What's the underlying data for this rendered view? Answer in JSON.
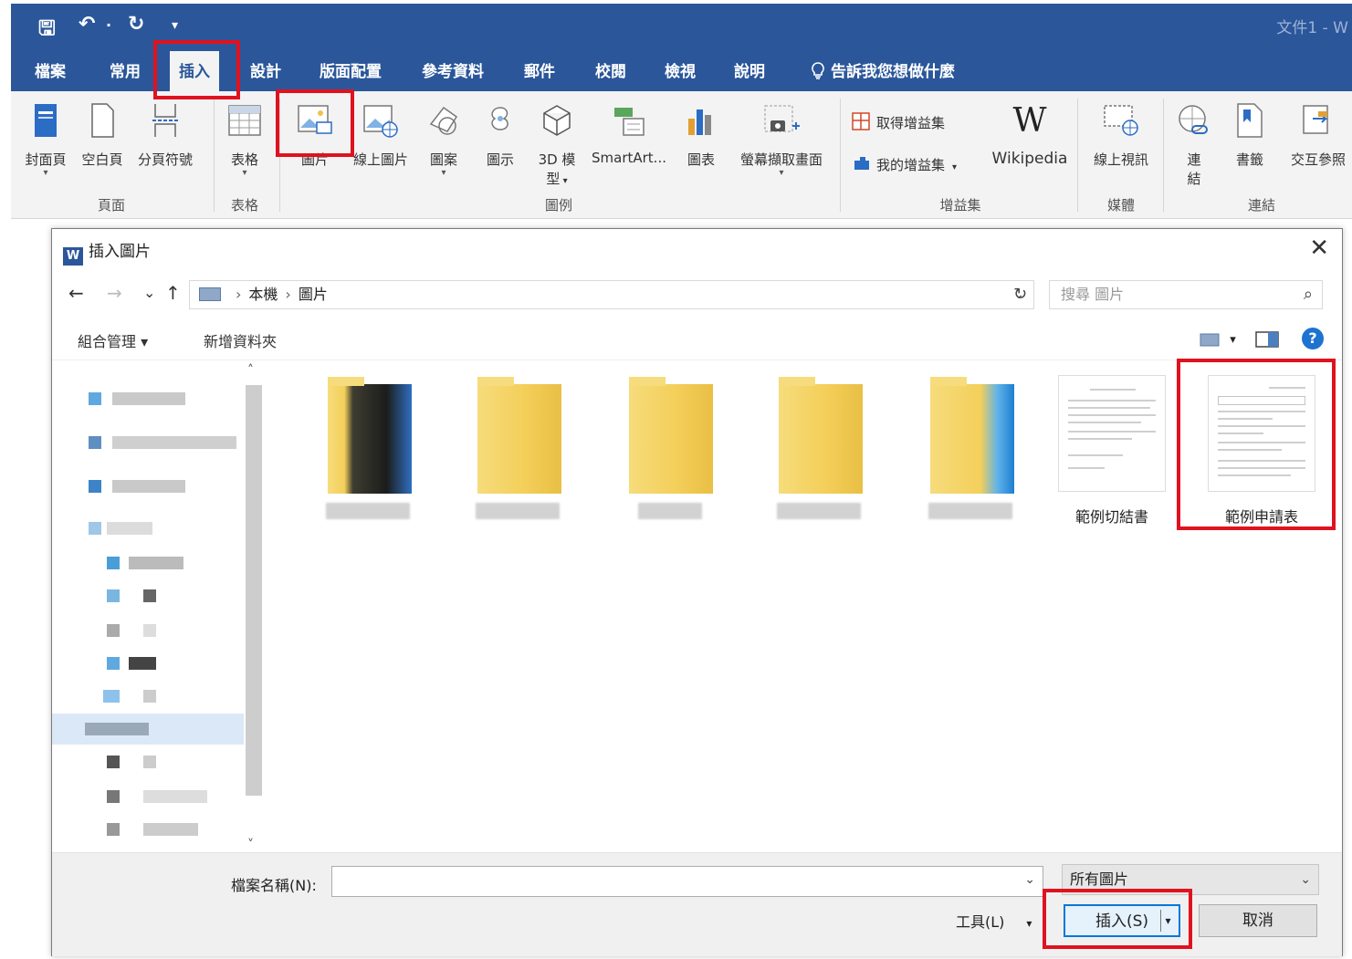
{
  "window": {
    "doc_title": "文件1 - W",
    "qat": {
      "save": "🖫",
      "undo": "↶",
      "undo_dd": "·",
      "redo": "↻",
      "more": "▾"
    }
  },
  "tabs": [
    "檔案",
    "常用",
    "插入",
    "設計",
    "版面配置",
    "參考資料",
    "郵件",
    "校閱",
    "檢視",
    "說明"
  ],
  "tell_me": "告訴我您想做什麼",
  "ribbon": {
    "pages": {
      "cover": "封面頁",
      "blank": "空白頁",
      "break": "分頁符號",
      "group": "頁面"
    },
    "tables": {
      "table": "表格",
      "group": "表格"
    },
    "illustrations": {
      "picture": "圖片",
      "online_picture": "線上圖片",
      "shapes": "圖案",
      "icons": "圖示",
      "model3d": "3D 模",
      "model3d_line2": "型",
      "smartart": "SmartArt...",
      "chart": "圖表",
      "screenshot": "螢幕擷取畫面",
      "group": "圖例"
    },
    "addins": {
      "get": "取得增益集",
      "my": "我的增益集",
      "wikipedia": "Wikipedia",
      "wiki_icon": "W",
      "group": "增益集"
    },
    "media": {
      "online_video": "線上視訊",
      "group": "媒體"
    },
    "links": {
      "link": "連",
      "link_line2": "結",
      "bookmark": "書籤",
      "xref": "交互參照",
      "group": "連結"
    }
  },
  "dialog": {
    "title": "插入圖片",
    "word_icon": "W",
    "close": "✕",
    "nav": {
      "back": "←",
      "forward": "→",
      "recent": "⌄",
      "up": "↑"
    },
    "breadcrumb": [
      "本機",
      "圖片"
    ],
    "breadcrumb_sep": "›",
    "address_dd": "⌄",
    "refresh": "↻",
    "search_placeholder": "搜尋 圖片",
    "search_icon": "⌕",
    "organize": "組合管理 ▾",
    "new_folder": "新增資料夾",
    "view_dd": "▾",
    "help": "?",
    "scroll_up": "˄",
    "scroll_down": "˅",
    "files": [
      {
        "type": "folder-blurred",
        "name": ""
      },
      {
        "type": "folder",
        "name": ""
      },
      {
        "type": "folder",
        "name": ""
      },
      {
        "type": "folder",
        "name": ""
      },
      {
        "type": "folder-blurred",
        "name": ""
      },
      {
        "type": "document",
        "name": "範例切結書"
      },
      {
        "type": "document",
        "name": "範例申請表"
      }
    ],
    "filename_label": "檔案名稱(N):",
    "filename_value": "",
    "filename_dd": "⌄",
    "filter": "所有圖片",
    "filter_dd": "⌄",
    "tools": "工具(L)",
    "tools_dd": "▾",
    "insert": "插入(S)",
    "insert_dd": "▾",
    "cancel": "取消"
  },
  "colors": {
    "word_blue": "#2b579a",
    "highlight_red": "#e0121f",
    "folder_yellow": "#f4cf5a",
    "accent_blue": "#0078d7"
  }
}
